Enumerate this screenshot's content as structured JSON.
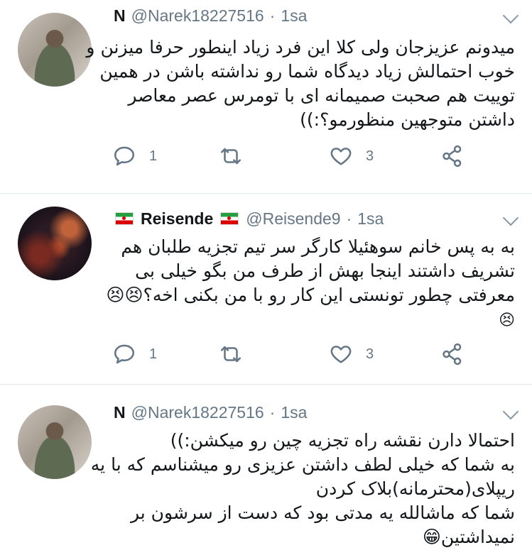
{
  "tweets": [
    {
      "name": "N",
      "handle": "@Narek18227516",
      "separator": "·",
      "time": "1sa",
      "lines": [
        "میدونم عزیزجان ولی کلا این فرد زیاد اینطور حرفا میزنن و",
        "خوب احتمالش زیاد دیدگاه شما رو نداشته باشن در همین",
        "توییت هم صحبت صمیمانه ای با تومرس عصر معاصر",
        "داشتن متوجهین منظورمو؟:))"
      ],
      "reply_count": "1",
      "retweet_count": "",
      "like_count": "3"
    },
    {
      "name": "Reisende",
      "handle": "@Reisende9",
      "separator": "·",
      "time": "1sa",
      "lines": [
        "به به پس خانم سوهئیلا  کارگر سر تیم تجزیه طلبان هم",
        "تشریف داشتند اینجا بهش از طرف من بگو خیلی بی",
        "معرفتی چطور تونستی این کار رو با من بکنی اخه؟😣😣"
      ],
      "trailing_emoji": "😣",
      "reply_count": "1",
      "retweet_count": "",
      "like_count": "3"
    },
    {
      "name": "N",
      "handle": "@Narek18227516",
      "separator": "·",
      "time": "1sa",
      "lines": [
        "احتمالا دارن نقشه راه تجزیه چین رو میکشن:))",
        "به شما که خیلی لطف داشتن عزیزی رو میشناسم که با یه",
        "ریپلای(محترمانه)بلاک کردن",
        "شما که ماشالله یه مدتی بود که دست از سرشون بر",
        "نمیداشتین😁"
      ]
    }
  ],
  "icons": {
    "reply": "reply-icon",
    "retweet": "retweet-icon",
    "like": "heart-icon",
    "share": "share-icon",
    "menu": "chevron-down-icon"
  },
  "colors": {
    "icon_gray": "#657786",
    "divider": "#e1e8ed",
    "flag_green": "#239f40",
    "flag_red": "#da0000"
  }
}
